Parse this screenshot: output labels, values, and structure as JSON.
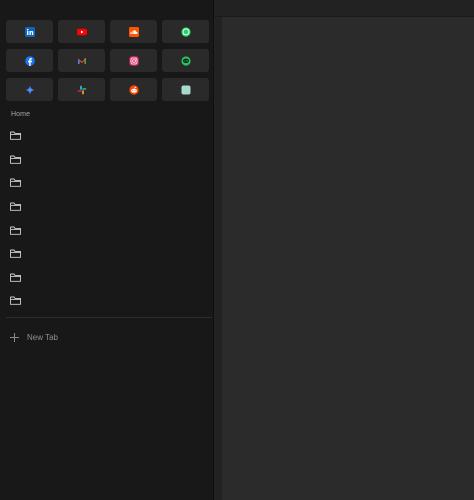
{
  "toolbar": {
    "buttons": [
      {
        "icon": "customize-icon",
        "enabled": true
      },
      {
        "icon": "sidebar-toggle-icon",
        "enabled": true
      },
      {
        "icon": "download-icon",
        "enabled": true
      },
      {
        "icon": "back-arrow-icon",
        "enabled": false
      },
      {
        "icon": "forward-arrow-icon",
        "enabled": false
      },
      {
        "icon": "reload-icon",
        "enabled": false
      }
    ]
  },
  "pinned_tabs": [
    {
      "icon": "linkedin-icon",
      "color": "#0a66c2"
    },
    {
      "icon": "youtube-icon",
      "color": "#ff0000"
    },
    {
      "icon": "soundcloud-icon",
      "color": "#ff5500"
    },
    {
      "icon": "whatsapp-icon",
      "color": "#25d366"
    },
    {
      "icon": "facebook-icon",
      "color": "#1877f2"
    },
    {
      "icon": "gmail-icon",
      "color": "#ea4335"
    },
    {
      "icon": "instagram-icon",
      "color": "#e1306c"
    },
    {
      "icon": "line-icon",
      "color": "#22c55e"
    },
    {
      "icon": "sparkle-icon",
      "color": "#4f8cff"
    },
    {
      "icon": "slack-icon",
      "color": "#e01e5a"
    },
    {
      "icon": "reddit-icon",
      "color": "#ff4500"
    },
    {
      "icon": "app-tile-icon",
      "color": "#a9d8cf"
    }
  ],
  "sidebar": {
    "section_label": "Home",
    "folders": [
      {
        "icon": "folder-icon"
      },
      {
        "icon": "folder-icon"
      },
      {
        "icon": "folder-icon"
      },
      {
        "icon": "folder-icon"
      },
      {
        "icon": "folder-icon"
      },
      {
        "icon": "folder-icon"
      },
      {
        "icon": "folder-icon"
      },
      {
        "icon": "folder-icon"
      }
    ],
    "new_tab_label": "New Tab"
  },
  "colors": {
    "sidebar_bg": "#181818",
    "content_bg": "#2b2b2b",
    "pin_bg": "#2a2a2a"
  }
}
